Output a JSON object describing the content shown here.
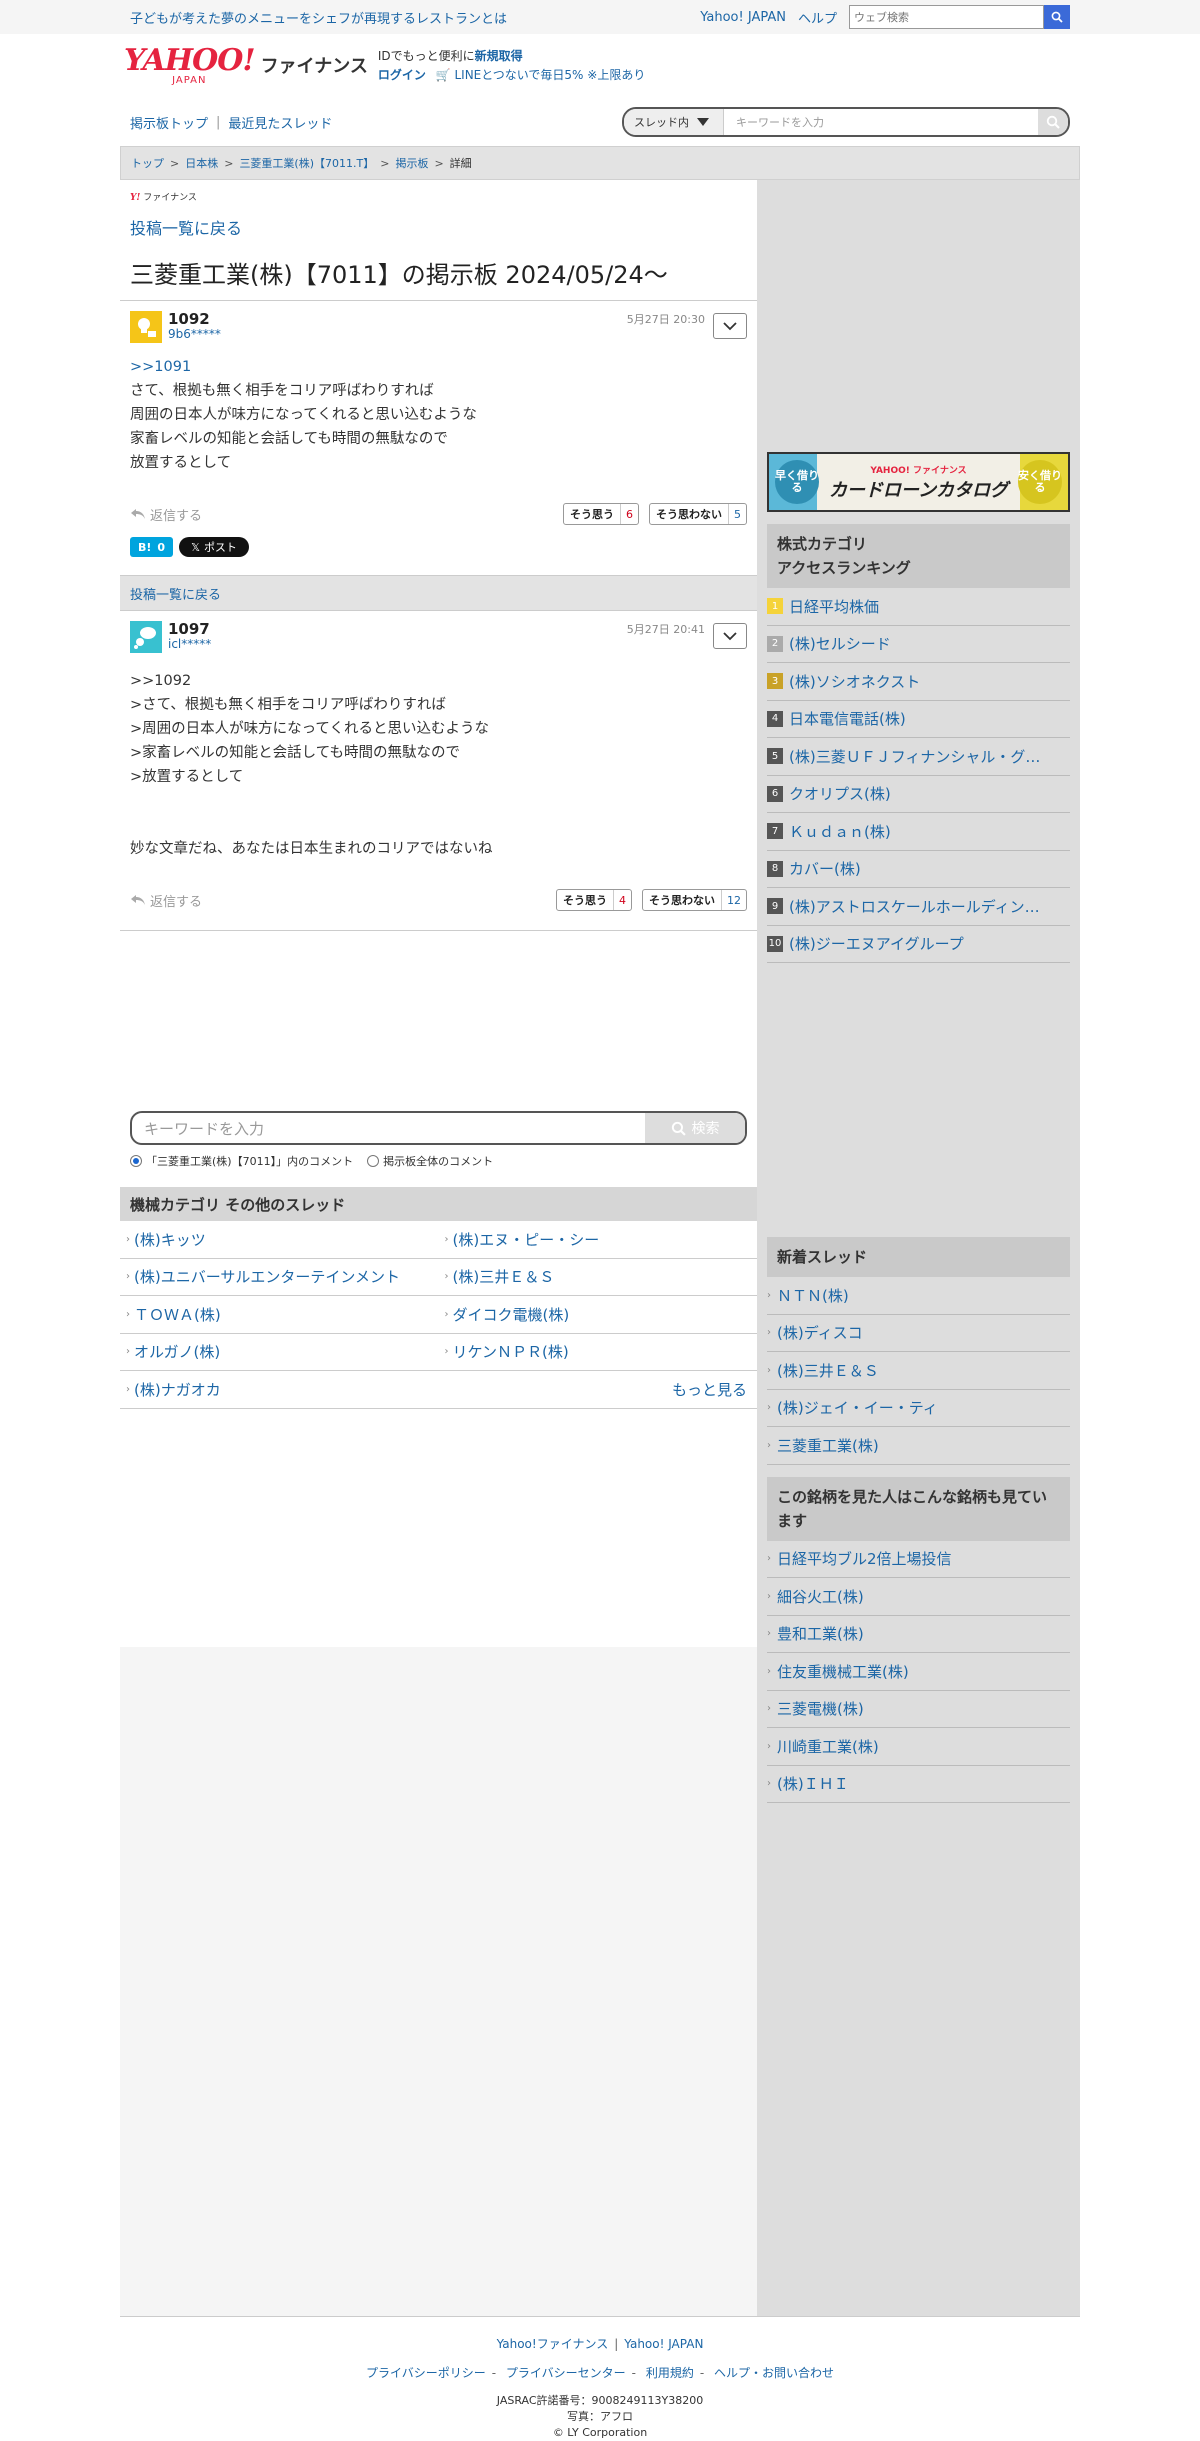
{
  "topbar": {
    "promo": "子どもが考えた夢のメニューをシェフが再現するレストランとは",
    "yahoo_japan": "Yahoo! JAPAN",
    "help": "ヘルプ",
    "search_placeholder": "ウェブ検索"
  },
  "header": {
    "logo_yahoo": "YAHOO!",
    "logo_japan": "JAPAN",
    "logo_finance": "ファイナンス",
    "id_text": "IDでもっと便利に",
    "signup": "新規取得",
    "login": "ログイン",
    "line_text": "LINEとつないで毎日5% ※上限あり"
  },
  "nav": {
    "board_top": "掲示板トップ",
    "recent_threads": "最近見たスレッド",
    "scope": "スレッド内",
    "search_placeholder": "キーワードを入力"
  },
  "breadcrumb": [
    "トップ",
    "日本株",
    "三菱重工業(株)【7011.T】",
    "掲示板",
    "詳細"
  ],
  "main": {
    "mini_logo_y": "Y!",
    "mini_logo_text": "ファイナンス",
    "back_to_list": "投稿一覧に戻る",
    "board_title": "三菱重工業(株)【7011】の掲示板 2024/05/24〜"
  },
  "posts": [
    {
      "number": "1092",
      "user": "9b6*****",
      "date": "5月27日 20:30",
      "reply_link": ">>1091",
      "body": "さて、根拠も無く相手をコリア呼ばわりすれば\n周囲の日本人が味方になってくれると思い込むような\n家畜レベルの知能と会話しても時間の無駄なので\n放置するとして",
      "reply": "返信する",
      "agree": "そう思う",
      "agree_count": "6",
      "disagree": "そう思わない",
      "disagree_count": "5",
      "hatena_label": "B!",
      "hatena_count": "0",
      "x_post": "ポスト"
    },
    {
      "number": "1097",
      "user": "icl*****",
      "date": "5月27日 20:41",
      "body": ">>1092\n>さて、根拠も無く相手をコリア呼ばわりすれば\n>周囲の日本人が味方になってくれると思い込むような\n>家畜レベルの知能と会話しても時間の無駄なので\n>放置するとして\n\n\n妙な文章だね、あなたは日本生まれのコリアではないね",
      "reply": "返信する",
      "agree": "そう思う",
      "agree_count": "4",
      "disagree": "そう思わない",
      "disagree_count": "12"
    }
  ],
  "back_bar": "投稿一覧に戻る",
  "keyword_search": {
    "placeholder": "キーワードを入力",
    "button": "検索",
    "radio_thread": "「三菱重工業(株)【7011】」内のコメント",
    "radio_all": "掲示板全体のコメント"
  },
  "category": {
    "title": "機械カテゴリ その他のスレッド",
    "items": [
      "(株)キッツ",
      "(株)エヌ・ピー・シー",
      "(株)ユニバーサルエンターテインメント",
      "(株)三井Ｅ＆Ｓ",
      "ＴＯＷＡ(株)",
      "ダイコク電機(株)",
      "オルガノ(株)",
      "リケンＮＰＲ(株)",
      "(株)ナガオカ"
    ],
    "more": "もっと見る"
  },
  "sidebar": {
    "ad": {
      "left": "早く借りる",
      "brand": "YAHOO! ファイナンス",
      "title": "カードローンカタログ",
      "right": "安く借りる"
    },
    "ranking_title_1": "株式カテゴリ",
    "ranking_title_2": "アクセスランキング",
    "ranking": [
      {
        "no": "1",
        "name": "日経平均株価"
      },
      {
        "no": "2",
        "name": "(株)セルシード"
      },
      {
        "no": "3",
        "name": "(株)ソシオネクスト"
      },
      {
        "no": "4",
        "name": "日本電信電話(株)"
      },
      {
        "no": "5",
        "name": "(株)三菱ＵＦＪフィナンシャル・グ…"
      },
      {
        "no": "6",
        "name": "クオリプス(株)"
      },
      {
        "no": "7",
        "name": "Ｋｕｄａｎ(株)"
      },
      {
        "no": "8",
        "name": "カバー(株)"
      },
      {
        "no": "9",
        "name": "(株)アストロスケールホールディン…"
      },
      {
        "no": "10",
        "name": "(株)ジーエヌアイグループ"
      }
    ],
    "new_threads_title": "新着スレッド",
    "new_threads": [
      "ＮＴＮ(株)",
      "(株)ディスコ",
      "(株)三井Ｅ＆Ｓ",
      "(株)ジェイ・イー・ティ",
      "三菱重工業(株)"
    ],
    "also_viewed_title": "この銘柄を見た人はこんな銘柄も見ています",
    "also_viewed": [
      "日経平均ブル2倍上場投信",
      "細谷火工(株)",
      "豊和工業(株)",
      "住友重機械工業(株)",
      "三菱電機(株)",
      "川崎重工業(株)",
      "(株)ＩＨＩ"
    ]
  },
  "footer": {
    "link_finance": "Yahoo!ファイナンス",
    "link_japan": "Yahoo! JAPAN",
    "privacy_policy": "プライバシーポリシー",
    "privacy_center": "プライバシーセンター",
    "terms": "利用規約",
    "help_contact": "ヘルプ・お問い合わせ",
    "jasrac": "JASRAC許諾番号：9008249113Y38200",
    "photo": "写真：アフロ",
    "copyright": "© LY Corporation"
  }
}
